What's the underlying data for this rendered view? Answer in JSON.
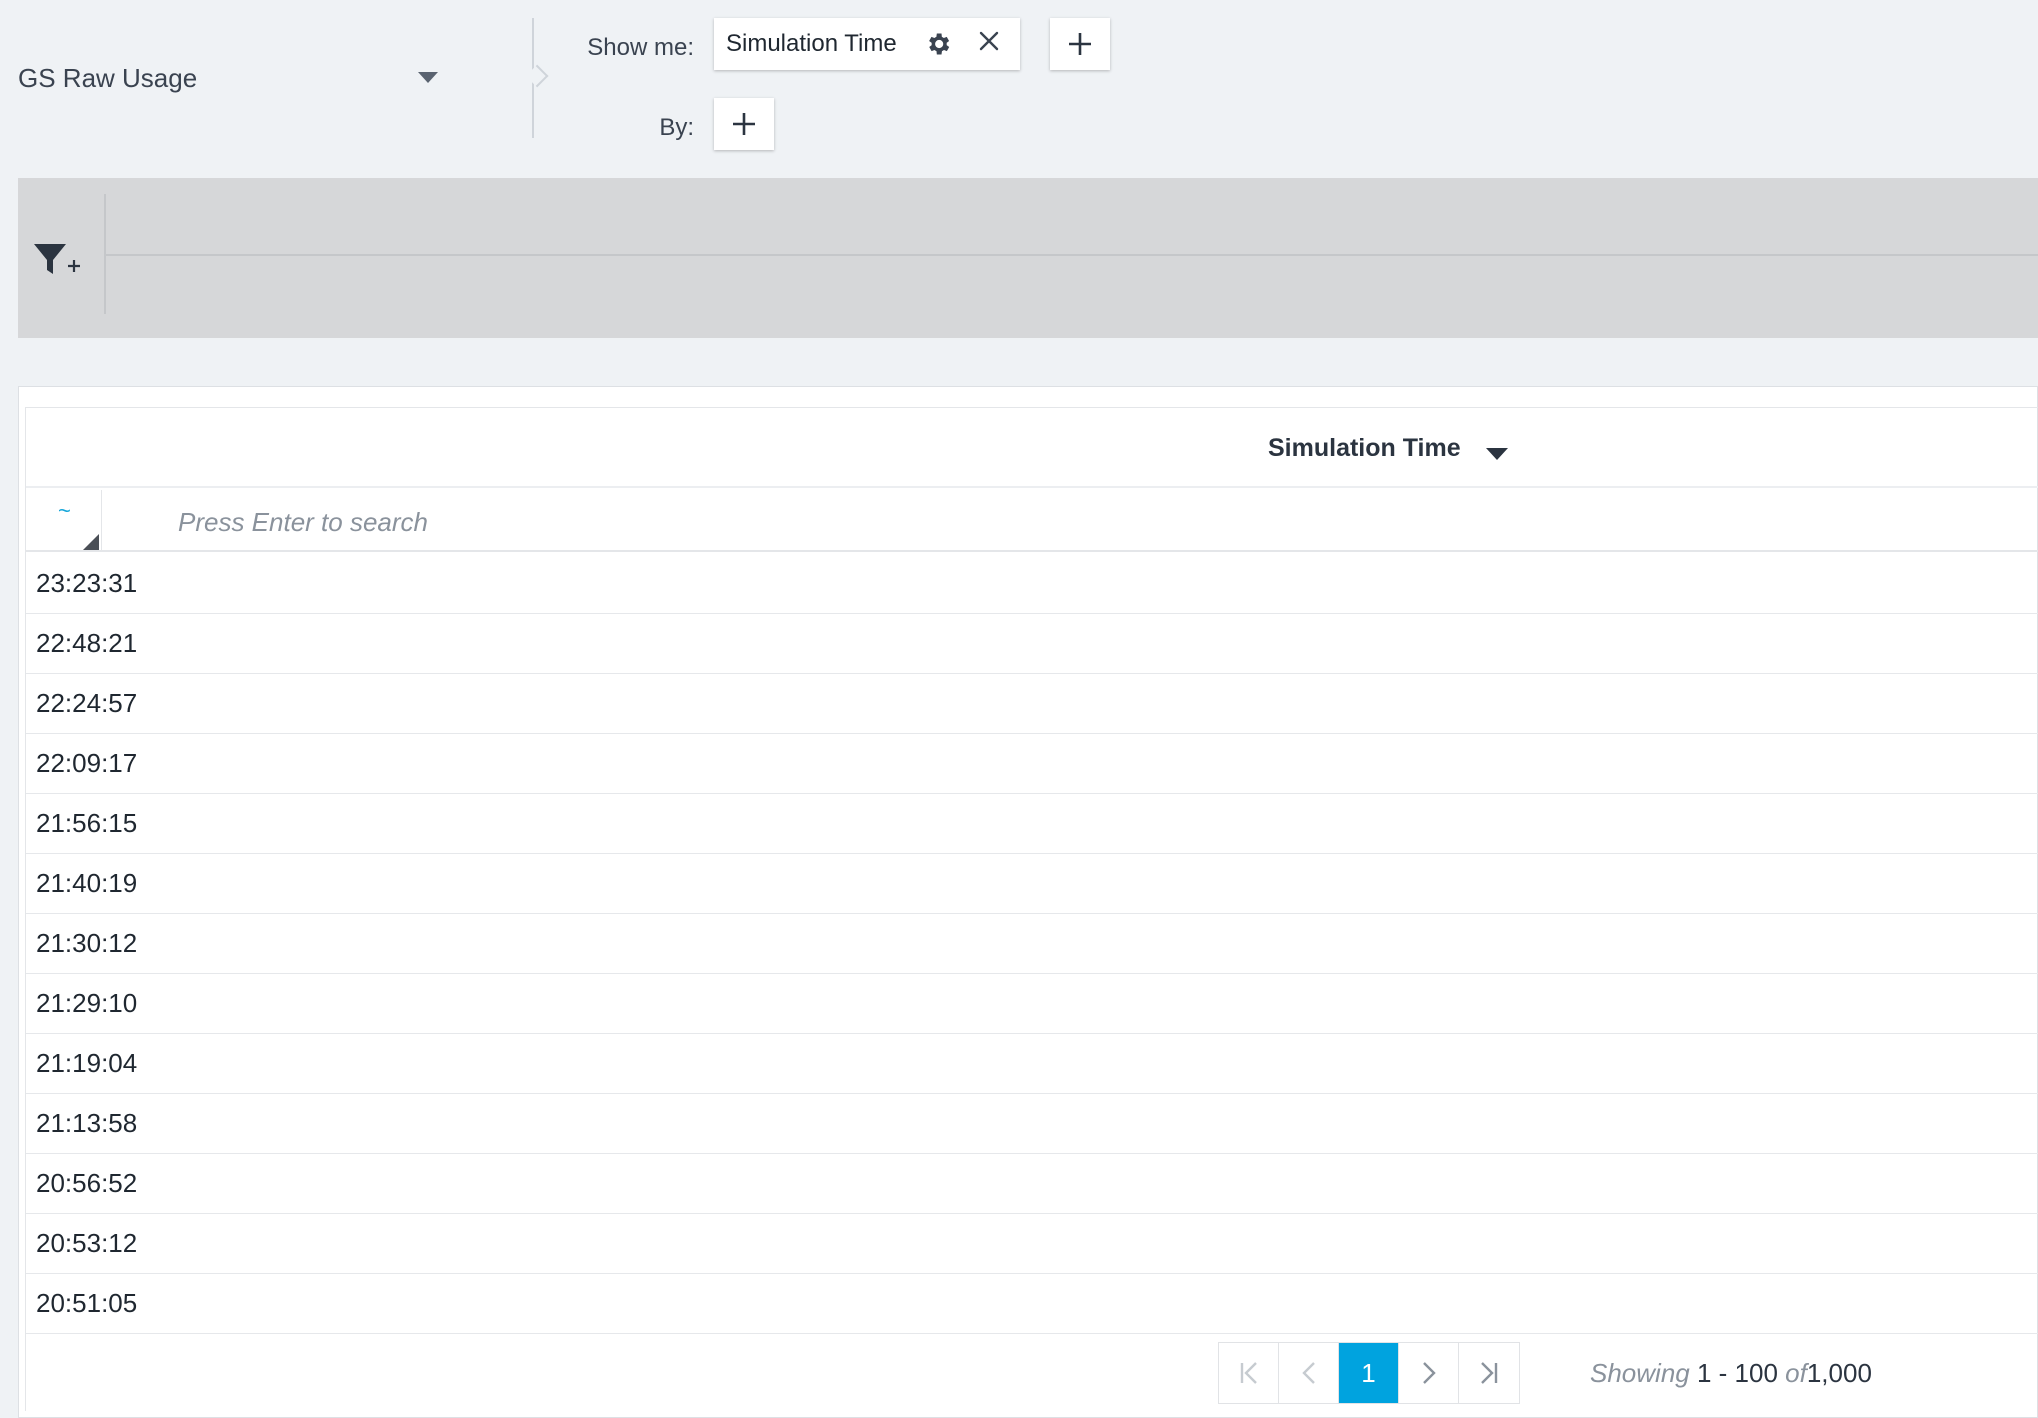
{
  "query": {
    "source_label": "GS Raw Usage",
    "show_me_label": "Show me:",
    "by_label": "By:",
    "metric_chip_label": "Simulation Time"
  },
  "icons": {
    "filter_add": "filter-plus-icon",
    "gear": "gear-icon",
    "close": "close-icon",
    "plus": "plus-icon"
  },
  "table": {
    "column_header": "Simulation Time",
    "search_operator": "~",
    "search_placeholder": "Press Enter to search",
    "rows": [
      "23:23:31",
      "22:48:21",
      "22:24:57",
      "22:09:17",
      "21:56:15",
      "21:40:19",
      "21:30:12",
      "21:29:10",
      "21:19:04",
      "21:13:58",
      "20:56:52",
      "20:53:12",
      "20:51:05"
    ]
  },
  "pagination": {
    "current_page": "1",
    "showing_word": "Showing",
    "range": "1 - 100",
    "of_word": "of",
    "total": "1,000"
  },
  "colors": {
    "accent": "#00a3df",
    "background": "#eff2f5",
    "filter_bar": "#d6d7d9"
  }
}
